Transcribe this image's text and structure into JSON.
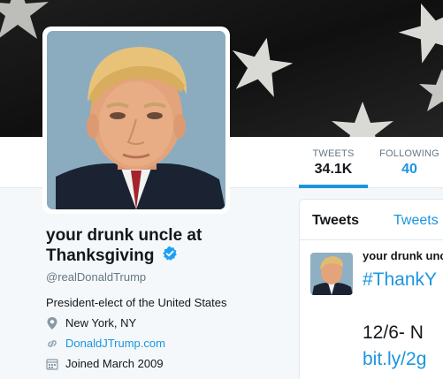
{
  "banner": {
    "star_icon": "star-icon"
  },
  "stats": [
    {
      "label": "TWEETS",
      "value": "34.1K",
      "active": true
    },
    {
      "label": "FOLLOWING",
      "value": "40",
      "active": false
    }
  ],
  "profile": {
    "name_line1": "your drunk uncle at",
    "name_line2": "Thanksgiving",
    "handle": "@realDonaldTrump",
    "bio": "President-elect of the United States",
    "location": "New York, NY",
    "website": "DonaldJTrump.com",
    "joined": "Joined March 2009"
  },
  "timeline": {
    "tabs": [
      "Tweets",
      "Tweets"
    ],
    "tweet": {
      "author": "your drunk unc",
      "line1": "#ThankY",
      "line2": "12/6- N",
      "line3": "bit.ly/2g"
    }
  },
  "colors": {
    "accent": "#1b95e0",
    "text": "#14171a",
    "muted": "#657786",
    "background": "#f5f8fa"
  }
}
